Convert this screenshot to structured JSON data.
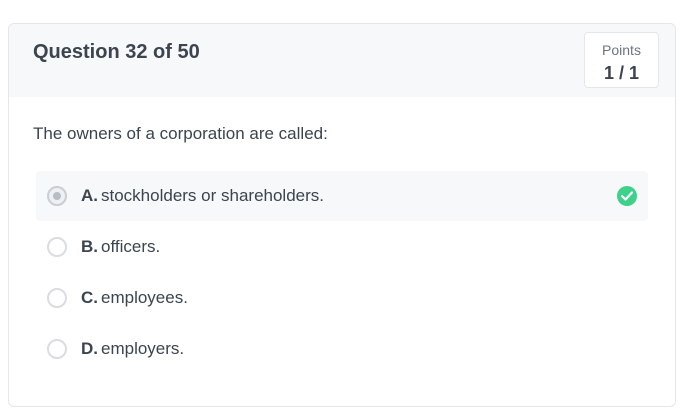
{
  "question": {
    "title": "Question 32 of 50",
    "text": "The owners of a corporation are called:"
  },
  "points": {
    "label": "Points",
    "value": "1 / 1"
  },
  "options": [
    {
      "letter": "A.",
      "text": "stockholders or shareholders.",
      "selected": true,
      "correct": true
    },
    {
      "letter": "B.",
      "text": "officers.",
      "selected": false,
      "correct": false
    },
    {
      "letter": "C.",
      "text": "employees.",
      "selected": false,
      "correct": false
    },
    {
      "letter": "D.",
      "text": "employers.",
      "selected": false,
      "correct": false
    }
  ],
  "colors": {
    "correct": "#3ed18c",
    "header_bg": "#f7f8f9",
    "text": "#3b444f"
  },
  "icons": {
    "correct": "check-circle-icon"
  }
}
